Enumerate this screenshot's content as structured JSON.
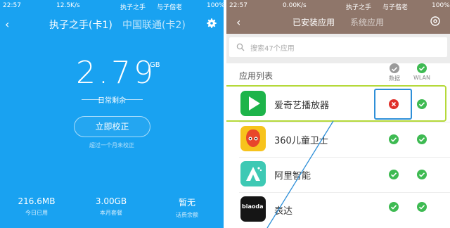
{
  "left_panel": {
    "status_bar": {
      "time": "22:57",
      "speed": "12.5K/s",
      "carrier": "执子之手",
      "carrier2": "与子偕老",
      "battery": "100%"
    },
    "tabs": [
      "执子之手(卡1)",
      "中国联通(卡2)"
    ],
    "usage": {
      "value": "2.79",
      "unit": "GB",
      "label": "日常剩余"
    },
    "calibrate_button": "立即校正",
    "calibrate_hint": "超过一个月未校正",
    "stats": [
      {
        "value": "216.6MB",
        "label": "今日已用"
      },
      {
        "value": "3.00GB",
        "label": "本月套餐"
      },
      {
        "value": "暂无",
        "label": "话费余额"
      }
    ],
    "icons": {
      "back": "back-arrow-icon",
      "settings": "gear-icon"
    }
  },
  "right_panel": {
    "status_bar": {
      "time": "22:57",
      "speed": "0.00K/s",
      "carrier": "执子之手",
      "carrier2": "与子偕老",
      "battery": "100%"
    },
    "tabs": [
      "已安装应用",
      "系统应用"
    ],
    "search": {
      "placeholder": "搜索47个应用"
    },
    "list_header": "应用列表",
    "columns": [
      "数据",
      "WLAN"
    ],
    "apps": [
      {
        "name": "爱奇艺播放器",
        "data": false,
        "wlan": true,
        "icon": "iqiyi-icon",
        "highlighted": true
      },
      {
        "name": "360儿童卫士",
        "data": true,
        "wlan": true,
        "icon": "360-kids-icon",
        "highlighted": false
      },
      {
        "name": "阿里智能",
        "data": true,
        "wlan": true,
        "icon": "ali-smart-icon",
        "highlighted": false
      },
      {
        "name": "表达",
        "data": true,
        "wlan": true,
        "icon": "biaoda-icon",
        "icon_text": "biaoda",
        "highlighted": false
      }
    ],
    "colors": {
      "accent_green": "#3EBA52",
      "blocked_red": "#E0302A",
      "highlight_green": "#B5D93A",
      "highlight_blue": "#2E8FD8",
      "topbar": "#8F766A"
    }
  }
}
